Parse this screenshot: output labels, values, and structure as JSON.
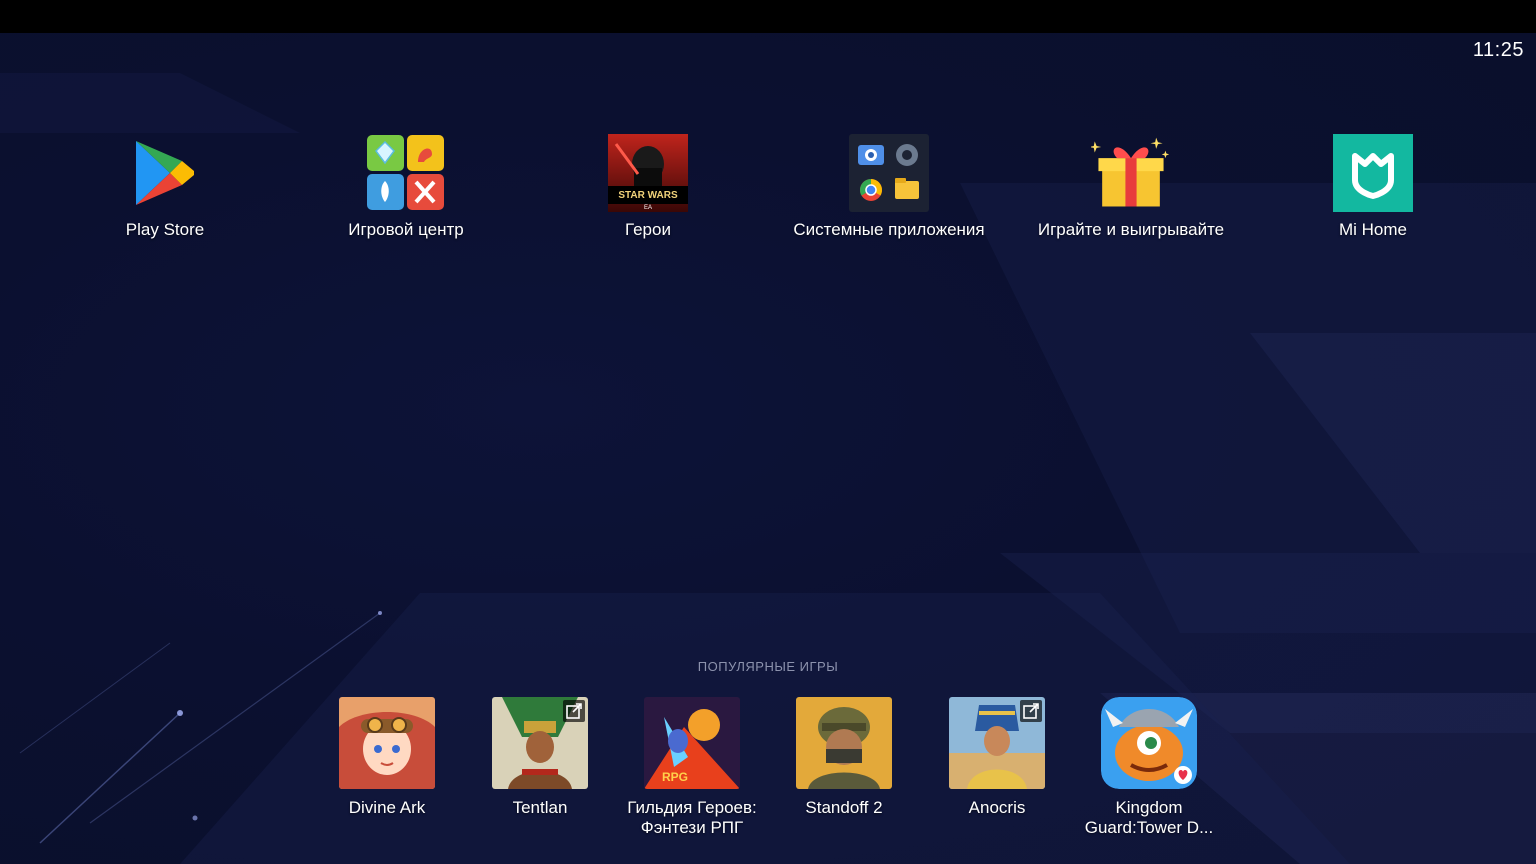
{
  "status_bar": {
    "time": "11:25"
  },
  "apps": [
    {
      "label": "Play Store",
      "icon": "play-store-icon"
    },
    {
      "label": "Игровой центр",
      "icon": "game-center-icon"
    },
    {
      "label": "Герои",
      "icon": "star-wars-heroes-icon"
    },
    {
      "label": "Системные приложения",
      "icon": "system-apps-folder-icon"
    },
    {
      "label": "Играйте и выигрывайте",
      "icon": "gift-icon"
    },
    {
      "label": "Mi Home",
      "icon": "mi-home-icon"
    }
  ],
  "popular_games": {
    "title": "ПОПУЛЯРНЫЕ ИГРЫ",
    "items": [
      {
        "label": "Divine Ark",
        "icon": "divine-ark-icon",
        "external": false
      },
      {
        "label": "Tentlan",
        "icon": "tentlan-icon",
        "external": true
      },
      {
        "label": "Гильдия Героев: Фэнтези РПГ",
        "icon": "guild-of-heroes-icon",
        "external": false
      },
      {
        "label": "Standoff 2",
        "icon": "standoff-2-icon",
        "external": false
      },
      {
        "label": "Anocris",
        "icon": "anocris-icon",
        "external": true
      },
      {
        "label": "Kingdom Guard:Tower D...",
        "icon": "kingdom-guard-icon",
        "external": false
      }
    ]
  },
  "colors": {
    "background": "#0b1030",
    "accent_teal": "#13b8a0",
    "label_muted": "#8c92ad"
  }
}
